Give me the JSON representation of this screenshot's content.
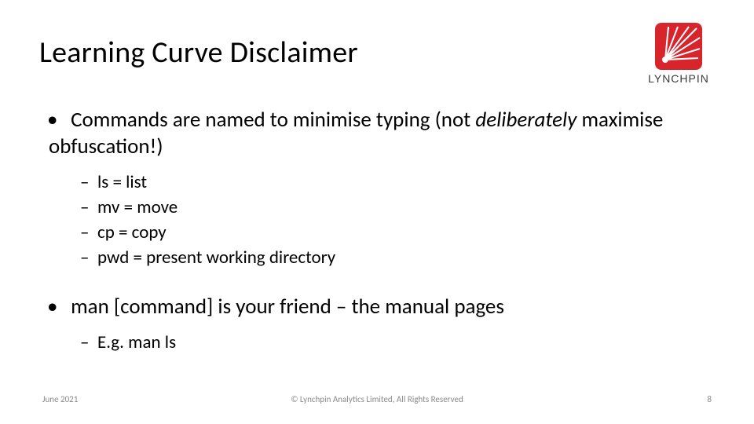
{
  "title": "Learning Curve Disclaimer",
  "brand": {
    "name": "LYNCHPIN"
  },
  "bullets": [
    {
      "text_pre": "Commands are named to minimise typing (not ",
      "emph": "deliberately",
      "text_post": " maximise obfuscation!)",
      "sub": [
        "ls = list",
        "mv = move",
        "cp = copy",
        "pwd = present working directory"
      ]
    },
    {
      "text_pre": "man [command] is your friend – the manual pages",
      "emph": "",
      "text_post": "",
      "sub": [
        "E.g. man ls"
      ]
    }
  ],
  "footer": {
    "date": "June 2021",
    "copyright": "© Lynchpin Analytics Limited, All Rights Reserved",
    "page": "8"
  }
}
